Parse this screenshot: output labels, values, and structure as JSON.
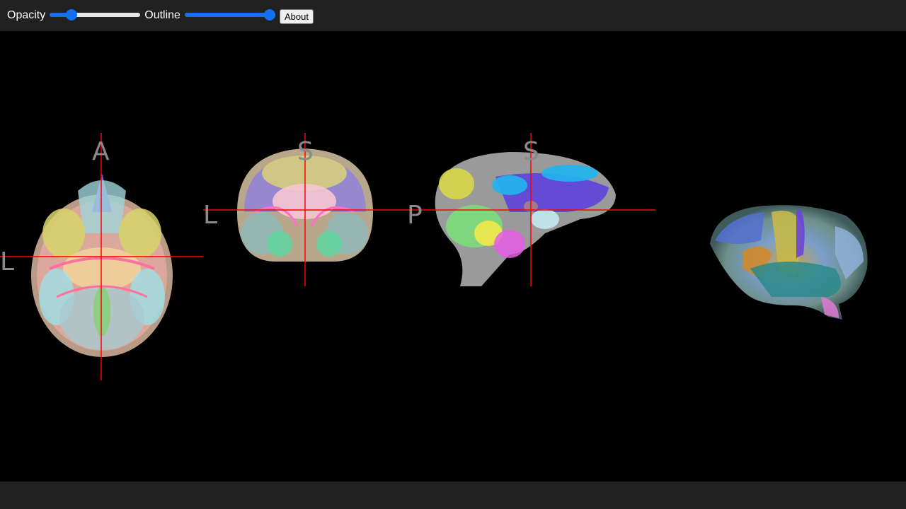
{
  "toolbar": {
    "opacity_label": "Opacity",
    "opacity_value": 0.2,
    "outline_label": "Outline",
    "outline_value": 1.0,
    "about_label": "About"
  },
  "views": {
    "axial": {
      "top": "A",
      "left": "L"
    },
    "coronal": {
      "top": "S",
      "left": "L"
    },
    "sagittal": {
      "top": "S",
      "left": "P"
    }
  },
  "colors": {
    "toolbar_bg": "#212121",
    "canvas_bg": "#000000",
    "crosshair": "#ff0000",
    "slider_accent": "#1470f0",
    "orientation_text": "#8a8a8a"
  }
}
